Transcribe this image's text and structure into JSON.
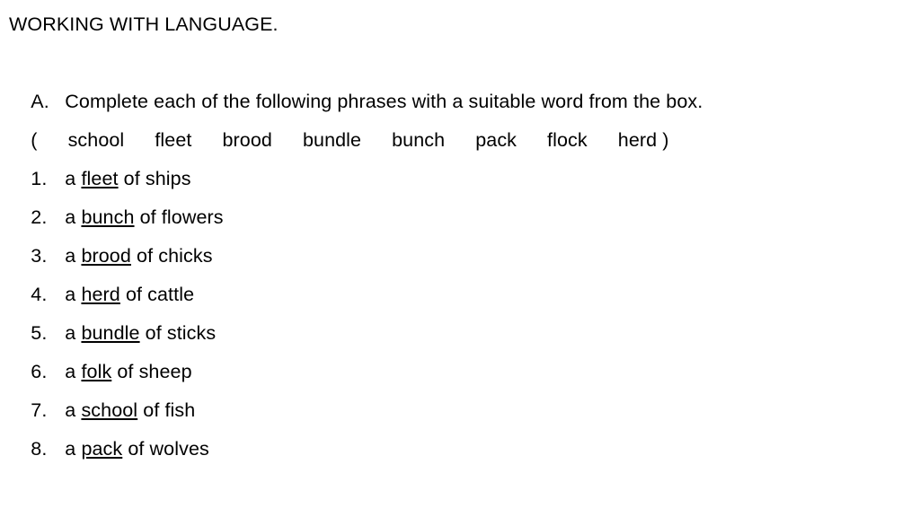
{
  "document": {
    "title": "WORKING WITH LANGUAGE.",
    "section_label": "A.",
    "instruction": "Complete each of the following phrases with a suitable word from the box.",
    "word_bank": {
      "open_paren": "(",
      "close_paren": ")",
      "words": [
        "school",
        "fleet",
        "brood",
        "bundle",
        "bunch",
        "pack",
        "flock",
        "herd"
      ]
    },
    "items": [
      {
        "number": "1.",
        "before": "a ",
        "answer": "fleet",
        "after": " of ships"
      },
      {
        "number": "2.",
        "before": "a ",
        "answer": "bunch",
        "after": " of flowers"
      },
      {
        "number": "3.",
        "before": "a ",
        "answer": "brood",
        "after": " of chicks"
      },
      {
        "number": "4.",
        "before": "a ",
        "answer": "herd",
        "after": " of cattle"
      },
      {
        "number": "5.",
        "before": "a ",
        "answer": "bundle",
        "after": " of sticks"
      },
      {
        "number": "6.",
        "before": "a ",
        "answer": "folk",
        "after": " of sheep"
      },
      {
        "number": "7.",
        "before": "a ",
        "answer": "school",
        "after": " of fish"
      },
      {
        "number": "8.",
        "before": "a ",
        "answer": "pack",
        "after": " of wolves"
      }
    ]
  },
  "colors": {
    "background": "#ffffff",
    "text": "#000000"
  }
}
